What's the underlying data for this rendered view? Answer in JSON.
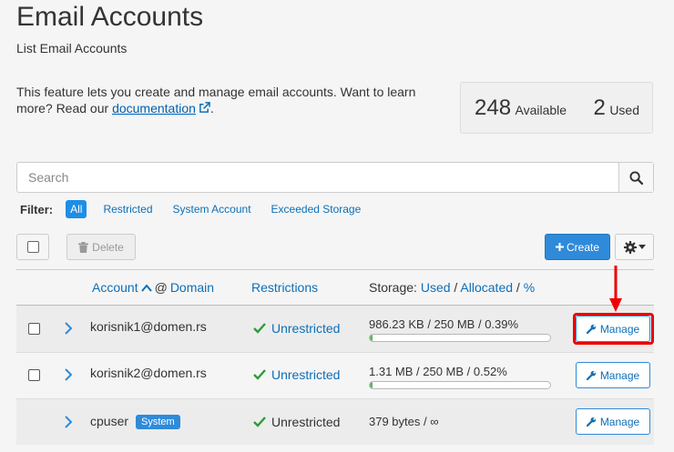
{
  "header": {
    "title": "Email Accounts",
    "subtitle": "List Email Accounts"
  },
  "intro": {
    "text_before": "This feature lets you create and manage email accounts. Want to learn more? Read our ",
    "link_text": "documentation",
    "text_after": "."
  },
  "stats": {
    "available_count": "248",
    "available_label": "Available",
    "used_count": "2",
    "used_label": "Used"
  },
  "search": {
    "placeholder": "Search"
  },
  "filter": {
    "label": "Filter:",
    "options": [
      "All",
      "Restricted",
      "System Account",
      "Exceeded Storage"
    ],
    "selected": "All"
  },
  "toolbar": {
    "delete_label": "Delete",
    "create_label": "Create"
  },
  "table": {
    "headers": {
      "account": "Account",
      "at": "@",
      "domain": "Domain",
      "restrictions": "Restrictions",
      "storage_prefix": "Storage:",
      "used": "Used",
      "slash1": "/",
      "allocated": "Allocated",
      "slash2": "/",
      "percent": "%"
    },
    "rows": [
      {
        "account": "korisnik1@domen.rs",
        "badge": "",
        "restriction": "Unrestricted",
        "storage": "986.23 KB / 250 MB / 0.39%",
        "usage_percent": 0.39,
        "manage": "Manage",
        "has_checkbox": true
      },
      {
        "account": "korisnik2@domen.rs",
        "badge": "",
        "restriction": "Unrestricted",
        "storage": "1.31 MB / 250 MB / 0.52%",
        "usage_percent": 0.52,
        "manage": "Manage",
        "has_checkbox": true
      },
      {
        "account": "cpuser",
        "badge": "System",
        "restriction": "Unrestricted",
        "storage": "379 bytes / ∞",
        "manage": "Manage",
        "has_checkbox": false
      }
    ]
  },
  "colors": {
    "accent": "#2f8ad9",
    "link": "#0d6fb8",
    "check": "#2a9d3a",
    "highlight": "#e00000"
  }
}
